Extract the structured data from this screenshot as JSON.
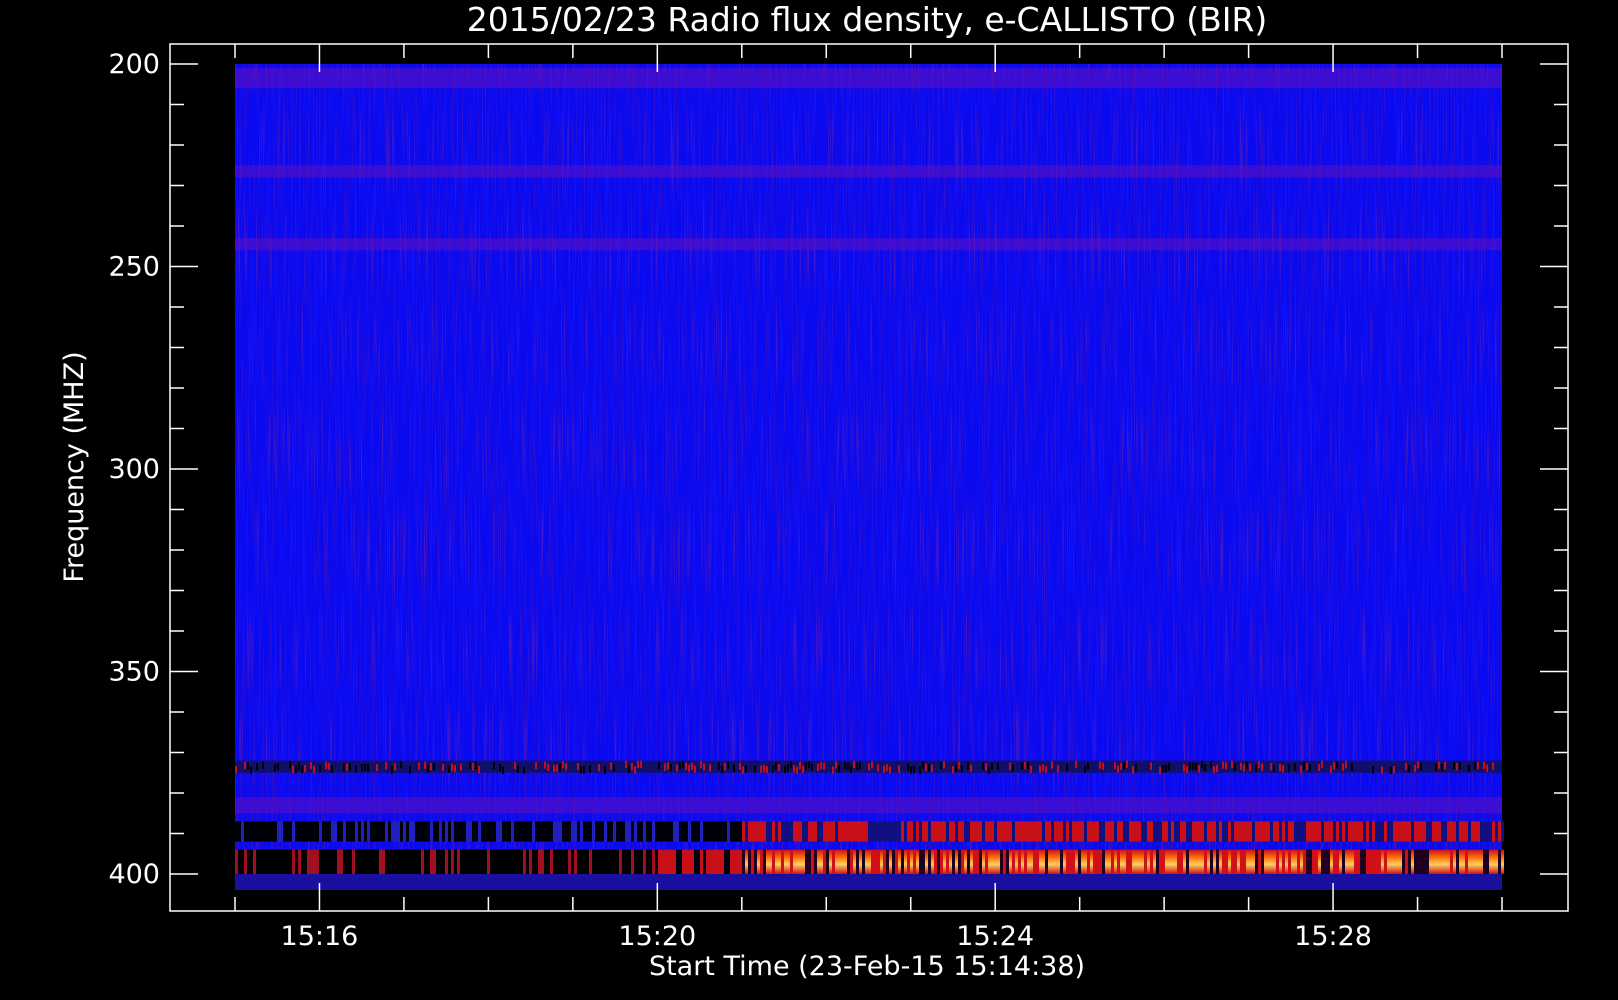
{
  "chart_data": {
    "type": "heatmap",
    "title": "2015/02/23  Radio flux density, e-CALLISTO (BIR)",
    "xlabel": "Start Time (23-Feb-15 15:14:38)",
    "ylabel": "Frequency (MHZ)",
    "x_range": [
      "15:15",
      "15:30"
    ],
    "y_range": [
      200,
      405
    ],
    "y_inverted": true,
    "x_ticks": [
      "15:16",
      "15:20",
      "15:24",
      "15:28"
    ],
    "y_ticks": [
      200,
      250,
      300,
      350,
      400
    ],
    "colormap": [
      "#000000",
      "#0000ff",
      "#d01018",
      "#ffb020"
    ],
    "background_level": "blue",
    "bands": [
      {
        "freq_range": [
          201,
          206
        ],
        "level": "faint red"
      },
      {
        "freq_range": [
          225,
          228
        ],
        "level": "faint red"
      },
      {
        "freq_range": [
          243,
          246
        ],
        "level": "faint red"
      },
      {
        "freq_range": [
          372,
          375
        ],
        "level": "dark with red"
      },
      {
        "freq_range": [
          381,
          385
        ],
        "level": "faint red"
      },
      {
        "freq_range": [
          387,
          392
        ],
        "level": "dark then red after 15:21"
      },
      {
        "freq_range": [
          394,
          400
        ],
        "level": "dark before 15:20, bright orange after 15:21"
      }
    ]
  }
}
